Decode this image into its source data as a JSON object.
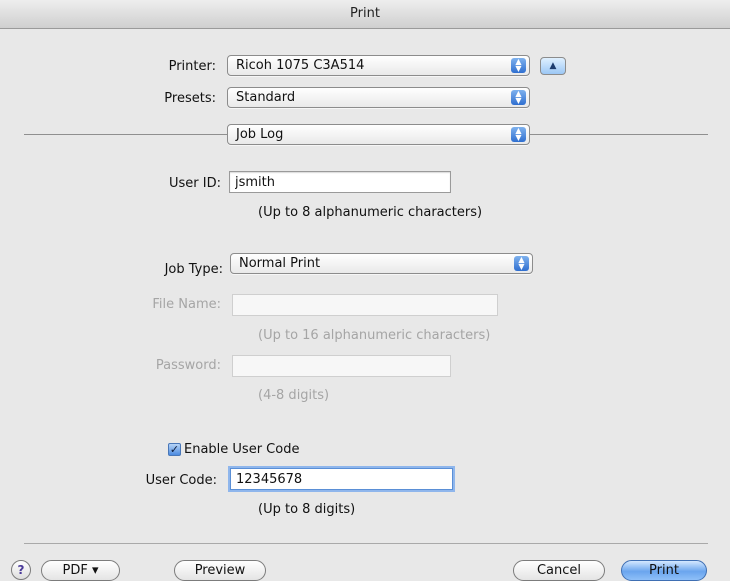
{
  "window": {
    "title": "Print"
  },
  "printer": {
    "label": "Printer:",
    "value": "Ricoh 1075 C3A514"
  },
  "presets": {
    "label": "Presets:",
    "value": "Standard"
  },
  "panel": {
    "value": "Job Log"
  },
  "user_id": {
    "label": "User ID:",
    "value": "jsmith",
    "hint": "(Up to 8 alphanumeric characters)"
  },
  "job_type": {
    "label": "Job Type:",
    "value": "Normal Print"
  },
  "file_name": {
    "label": "File Name:",
    "value": "",
    "hint": "(Up to 16 alphanumeric characters)"
  },
  "password": {
    "label": "Password:",
    "value": "",
    "hint": "(4-8 digits)"
  },
  "enable_user_code": {
    "label": "Enable User Code",
    "checked": true
  },
  "user_code": {
    "label": "User Code:",
    "value": "12345678",
    "hint": "(Up to 8 digits)"
  },
  "footer": {
    "help": "?",
    "pdf": "PDF ▾",
    "preview": "Preview",
    "cancel": "Cancel",
    "print": "Print"
  },
  "icons": {
    "popup_arrows": "updown-arrows-icon",
    "disclosure": "triangle-up-icon",
    "checkbox": "checkmark-icon",
    "help": "question-mark-icon"
  },
  "colors": {
    "accent": "#4b8ae0",
    "disabled_text": "#a5a5a5",
    "window_bg": "#e8e8e8"
  }
}
